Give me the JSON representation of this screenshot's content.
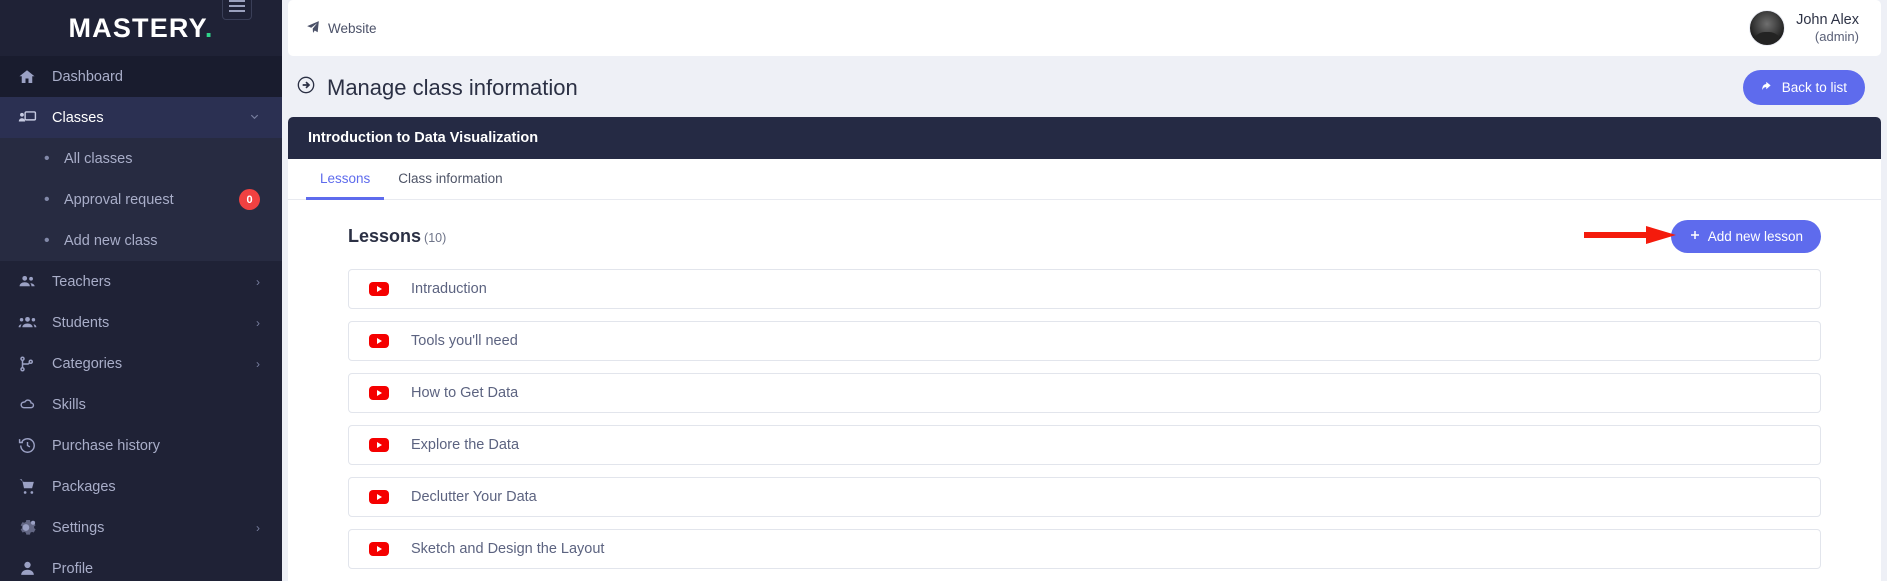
{
  "sidebar": {
    "brand": "MASTERY",
    "brand_dot": ".",
    "menu_toggle_icon": "hamburger-icon",
    "items": [
      {
        "label": "Dashboard",
        "icon": "home-icon",
        "chevron": "",
        "state": "hover"
      },
      {
        "label": "Classes",
        "icon": "classes-icon",
        "chevron": "⌄",
        "state": "selected"
      },
      {
        "label": "Teachers",
        "icon": "teachers-icon",
        "chevron": "›",
        "state": ""
      },
      {
        "label": "Students",
        "icon": "students-icon",
        "chevron": "›",
        "state": ""
      },
      {
        "label": "Categories",
        "icon": "categories-icon",
        "chevron": "›",
        "state": ""
      },
      {
        "label": "Skills",
        "icon": "skills-icon",
        "chevron": "",
        "state": ""
      },
      {
        "label": "Purchase history",
        "icon": "history-icon",
        "chevron": "",
        "state": ""
      },
      {
        "label": "Packages",
        "icon": "cart-icon",
        "chevron": "",
        "state": ""
      },
      {
        "label": "Settings",
        "icon": "gear-icon",
        "chevron": "›",
        "state": ""
      },
      {
        "label": "Profile",
        "icon": "person-icon",
        "chevron": "",
        "state": ""
      }
    ],
    "submenu": [
      {
        "label": "All classes",
        "badge": ""
      },
      {
        "label": "Approval request",
        "badge": "0"
      },
      {
        "label": "Add new class",
        "badge": ""
      }
    ]
  },
  "topbar": {
    "website_label": "Website",
    "website_icon": "paper-plane-icon",
    "user_name": "John Alex",
    "user_role": "(admin)",
    "avatar_icon": "avatar"
  },
  "page": {
    "title": "Manage class information",
    "title_icon": "circle-arrow-right-icon",
    "back_button": "Back to list",
    "back_button_icon": "reply-arrow-icon"
  },
  "class_card": {
    "name": "Introduction to Data Visualization",
    "tabs": [
      {
        "label": "Lessons",
        "active": true
      },
      {
        "label": "Class information",
        "active": false
      }
    ]
  },
  "lessons_section": {
    "heading": "Lessons",
    "count": "(10)",
    "add_button": "Add new lesson",
    "add_button_icon": "plus-icon",
    "annotation_icon": "red-arrow-annotation",
    "annotation_color": "#f41b0c",
    "lessons": [
      {
        "title": "Intraduction",
        "icon": "youtube-icon"
      },
      {
        "title": "Tools you'll need",
        "icon": "youtube-icon"
      },
      {
        "title": "How to Get Data",
        "icon": "youtube-icon"
      },
      {
        "title": "Explore the Data",
        "icon": "youtube-icon"
      },
      {
        "title": "Declutter Your Data",
        "icon": "youtube-icon"
      },
      {
        "title": "Sketch and Design the Layout",
        "icon": "youtube-icon"
      }
    ]
  },
  "colors": {
    "sidebar_bg": "#1f2236",
    "sidebar_selected": "#2b3052",
    "accent": "#5e6bed",
    "card_header": "#252a44",
    "badge_red": "#f04141",
    "brand_dot_green": "#2fd48a",
    "youtube_red": "#f50000"
  }
}
